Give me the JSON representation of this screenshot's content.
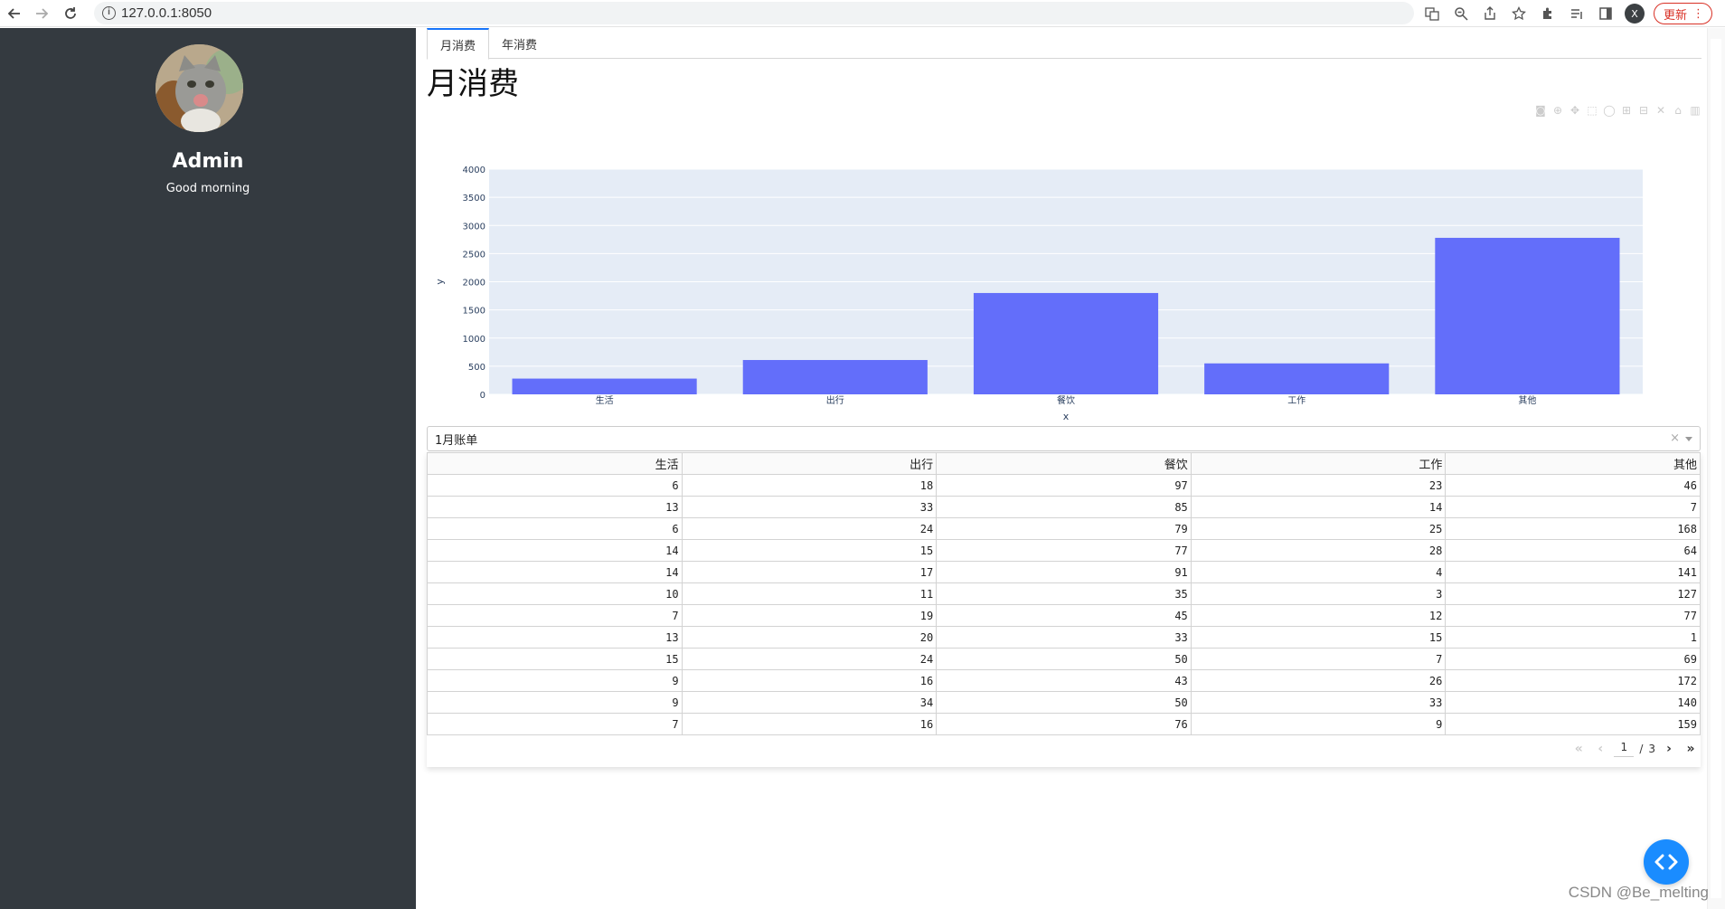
{
  "browser": {
    "url": "127.0.0.1:8050",
    "update_label": "更新",
    "profile_initial": "X"
  },
  "sidebar": {
    "name": "Admin",
    "greeting": "Good morning"
  },
  "tabs": [
    {
      "label": "月消费",
      "active": true
    },
    {
      "label": "年消费",
      "active": false
    }
  ],
  "page_title": "月消费",
  "chart_data": {
    "type": "bar",
    "categories": [
      "生活",
      "出行",
      "餐饮",
      "工作",
      "其他"
    ],
    "values": [
      280,
      610,
      1800,
      550,
      2780
    ],
    "xlabel": "x",
    "ylabel": "y",
    "ylim": [
      0,
      4000
    ],
    "yticks": [
      0,
      500,
      1000,
      1500,
      2000,
      2500,
      3000,
      3500,
      4000
    ],
    "bar_color": "#636efa",
    "plot_bg": "#e5ecf6",
    "grid": true
  },
  "dropdown": {
    "value": "1月账单",
    "clear": "×"
  },
  "table": {
    "columns": [
      "生活",
      "出行",
      "餐饮",
      "工作",
      "其他"
    ],
    "rows": [
      [
        6,
        18,
        97,
        23,
        46
      ],
      [
        13,
        33,
        85,
        14,
        7
      ],
      [
        6,
        24,
        79,
        25,
        168
      ],
      [
        14,
        15,
        77,
        28,
        64
      ],
      [
        14,
        17,
        91,
        4,
        141
      ],
      [
        10,
        11,
        35,
        3,
        127
      ],
      [
        7,
        19,
        45,
        12,
        77
      ],
      [
        13,
        20,
        33,
        15,
        1
      ],
      [
        15,
        24,
        50,
        7,
        69
      ],
      [
        9,
        16,
        43,
        26,
        172
      ],
      [
        9,
        34,
        50,
        33,
        140
      ],
      [
        7,
        16,
        76,
        9,
        159
      ]
    ]
  },
  "pager": {
    "current": "1",
    "separator": "/",
    "total": "3"
  },
  "watermark": "CSDN @Be_melting"
}
